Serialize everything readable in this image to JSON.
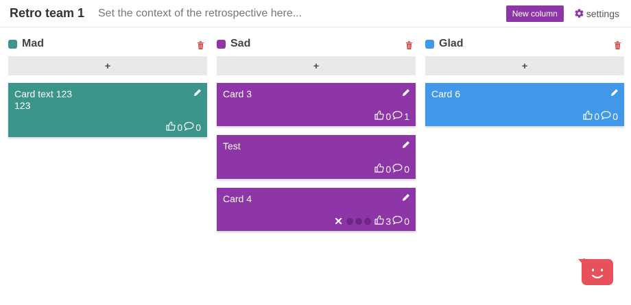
{
  "header": {
    "title": "Retro team 1",
    "context_placeholder": "Set the context of the retrospective here...",
    "new_column_label": "New column",
    "settings_label": "settings"
  },
  "colors": {
    "accent": "#8e35a7",
    "danger": "#e53935"
  },
  "columns": [
    {
      "title": "Mad",
      "color": "#3b958a",
      "add_label": "+",
      "cards": [
        {
          "text": "Card text 123\n123",
          "likes": "0",
          "comments": "0"
        }
      ]
    },
    {
      "title": "Sad",
      "color": "#8e35a7",
      "add_label": "+",
      "cards": [
        {
          "text": "Card 3",
          "likes": "0",
          "comments": "1"
        },
        {
          "text": "Test",
          "likes": "0",
          "comments": "0"
        },
        {
          "text": "Card 4",
          "likes": "3",
          "comments": "0",
          "has_extras": true
        }
      ]
    },
    {
      "title": "Glad",
      "color": "#4298e8",
      "add_label": "+",
      "cards": [
        {
          "text": "Card 6",
          "likes": "0",
          "comments": "0"
        }
      ]
    }
  ],
  "icons": {
    "settings": "gear-icon",
    "delete_column": "trash-icon",
    "edit_card": "pencil-icon",
    "like": "thumbs-up-icon",
    "comment": "speech-bubble-icon",
    "clear_votes": "close-icon",
    "chat": "chat-bot-icon"
  }
}
